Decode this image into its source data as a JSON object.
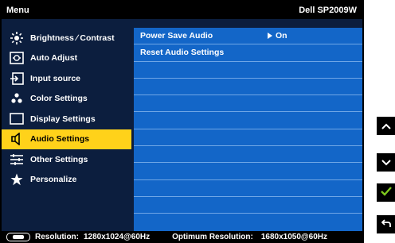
{
  "header": {
    "title": "Menu",
    "model": "Dell SP2009W"
  },
  "menu": {
    "items": [
      {
        "label": "Brightness ∕ Contrast",
        "icon": "brightness-icon"
      },
      {
        "label": "Auto Adjust",
        "icon": "auto-adjust-icon"
      },
      {
        "label": "Input source",
        "icon": "input-source-icon"
      },
      {
        "label": "Color Settings",
        "icon": "color-settings-icon"
      },
      {
        "label": "Display Settings",
        "icon": "display-icon"
      },
      {
        "label": "Audio Settings",
        "icon": "speaker-icon",
        "selected": true
      },
      {
        "label": "Other Settings",
        "icon": "other-settings-icon"
      },
      {
        "label": "Personalize",
        "icon": "star-icon"
      }
    ]
  },
  "audio": {
    "rows": [
      {
        "label": "Power Save Audio",
        "value": "On"
      },
      {
        "label": "Reset Audio Settings",
        "value": ""
      }
    ]
  },
  "status": {
    "resolution_label": "Resolution:",
    "resolution_value": "1280x1024@60Hz",
    "optimum_label": "Optimum Resolution:",
    "optimum_value": "1680x1050@60Hz"
  },
  "side_buttons": [
    "up-icon",
    "down-icon",
    "check-icon",
    "back-icon"
  ],
  "colors": {
    "panel_bg": "#0c1e3e",
    "content_bg": "#1366c8",
    "selected_bg": "#ffd21a",
    "check": "#7ec81e"
  }
}
